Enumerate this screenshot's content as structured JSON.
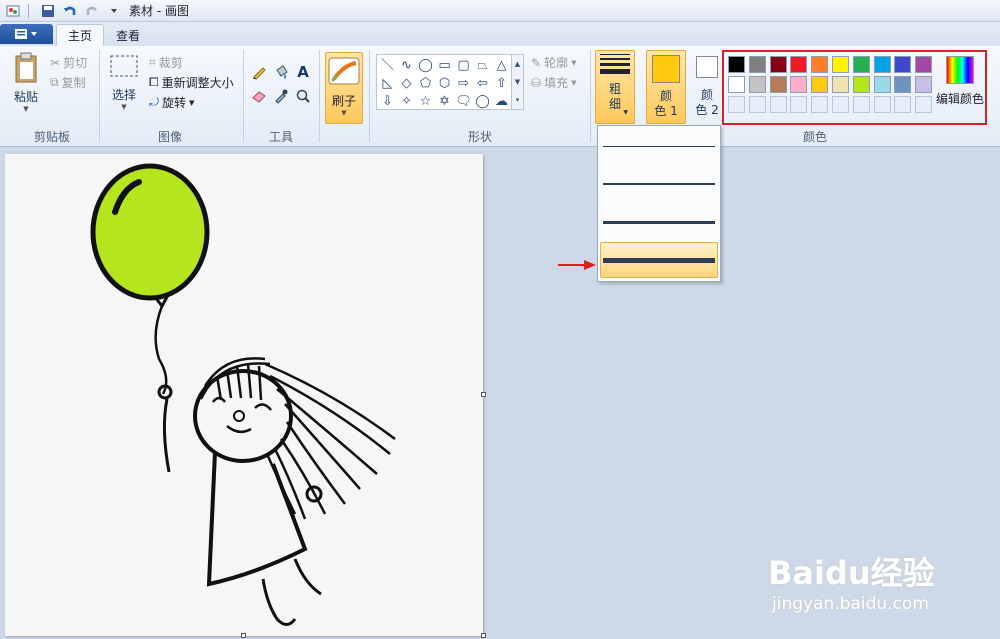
{
  "window": {
    "title": "素材 - 画图"
  },
  "tabs": [
    {
      "label": "主页",
      "active": true
    },
    {
      "label": "查看",
      "active": false
    }
  ],
  "clipboard": {
    "paste_label": "粘贴",
    "cut_label": "剪切",
    "copy_label": "复制",
    "group_label": "剪贴板"
  },
  "image": {
    "select_label": "选择",
    "crop_label": "裁剪",
    "resize_label": "重新调整大小",
    "rotate_label": "旋转",
    "group_label": "图像"
  },
  "tools": {
    "group_label": "工具",
    "items": [
      "pencil-icon",
      "fill-icon",
      "text-icon",
      "eraser-icon",
      "color-picker-icon",
      "magnifier-icon"
    ]
  },
  "brush": {
    "label": "刷子"
  },
  "shapes": {
    "group_label": "形状",
    "outline_label": "轮廓",
    "fill_label": "填充",
    "glyphs": [
      "＼",
      "∿",
      "◯",
      "▭",
      "▢",
      "⏢",
      "△",
      "◺",
      "◇",
      "⬠",
      "⬡",
      "⇨",
      "⇦",
      "⇧",
      "⇩",
      "✧",
      "☆",
      "✡",
      "🗨",
      "◯",
      "☁"
    ]
  },
  "size": {
    "label": "粗细",
    "char1": "粗",
    "char2": "细"
  },
  "colors": {
    "group_label": "颜色",
    "color1": {
      "label": "颜色 1",
      "char1": "颜",
      "char2": "色 1",
      "value": "#ffc90e"
    },
    "color2": {
      "label": "颜色 2",
      "char1": "颜",
      "char2": "色 2",
      "value": "#ffffff"
    },
    "edit_label": "编辑颜色",
    "row1": [
      "#000000",
      "#7f7f7f",
      "#880015",
      "#ed1c24",
      "#ff7f27",
      "#fff200",
      "#22b14c",
      "#00a2e8",
      "#3f48cc",
      "#a349a4"
    ],
    "row2": [
      "#ffffff",
      "#c3c3c3",
      "#b97a57",
      "#ffaec9",
      "#ffc90e",
      "#efe4b0",
      "#b5e61d",
      "#99d9ea",
      "#7092be",
      "#c8bfe7"
    ]
  },
  "size_dropdown": {
    "options": [
      {
        "thickness": 1,
        "selected": false
      },
      {
        "thickness": 2,
        "selected": false
      },
      {
        "thickness": 3,
        "selected": false
      },
      {
        "thickness": 5,
        "selected": true
      }
    ]
  },
  "watermark": {
    "brand": "Baidu经验",
    "url": "jingyan.baidu.com"
  }
}
